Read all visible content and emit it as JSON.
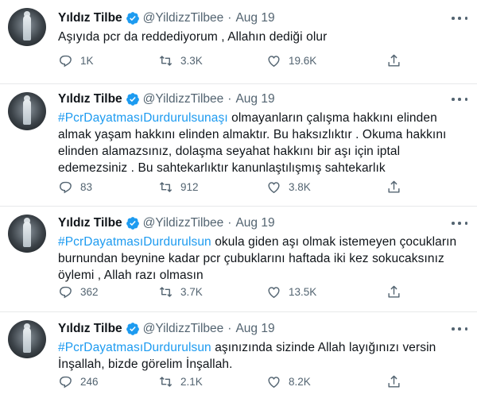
{
  "tweets": [
    {
      "name": "Yıldız Tilbe",
      "handle": "@YildizzTilbee",
      "separator": "·",
      "date": "Aug 19",
      "hashtag": "",
      "text": "Aşıyıda pcr da reddediyorum , Allahın dediği olur",
      "replies": "1K",
      "retweets": "3.3K",
      "likes": "19.6K"
    },
    {
      "name": "Yıldız Tilbe",
      "handle": "@YildizzTilbee",
      "separator": "·",
      "date": "Aug 19",
      "hashtag": "#PcrDayatmasıDurdurulsunaşı",
      "text": " olmayanların çalışma hakkını elinden almak yaşam hakkını elinden almaktır. Bu haksızlıktır . Okuma hakkını elinden alamazsınız, dolaşma seyahat hakkını bir aşı için iptal edemezsiniz . Bu sahtekarlıktır kanunlaştılışmış sahtekarlık",
      "replies": "83",
      "retweets": "912",
      "likes": "3.8K"
    },
    {
      "name": "Yıldız Tilbe",
      "handle": "@YildizzTilbee",
      "separator": "·",
      "date": "Aug 19",
      "hashtag": "#PcrDayatmasıDurdurulsun",
      "text": " okula giden aşı olmak istemeyen çocukların burnundan beynine kadar pcr çubuklarını haftada iki kez sokucaksınız öylemi , Allah  razı olmasın",
      "replies": "362",
      "retweets": "3.7K",
      "likes": "13.5K"
    },
    {
      "name": "Yıldız Tilbe",
      "handle": "@YildizzTilbee",
      "separator": "·",
      "date": "Aug 19",
      "hashtag": "#PcrDayatmasıDurdurulsun",
      "text": " aşınızında sizinde Allah layığınızı  versin İnşallah, bizde görelim İnşallah.",
      "replies": "246",
      "retweets": "2.1K",
      "likes": "8.2K"
    }
  ],
  "icons": {
    "reply": "reply-icon",
    "retweet": "retweet-icon",
    "like": "like-icon",
    "share": "share-icon",
    "verified": "verified-badge-icon",
    "more": "more-icon"
  },
  "colors": {
    "accent": "#1d9bf0",
    "secondary_text": "#536471",
    "primary_text": "#0f1419",
    "divider": "#e7e9ea"
  }
}
